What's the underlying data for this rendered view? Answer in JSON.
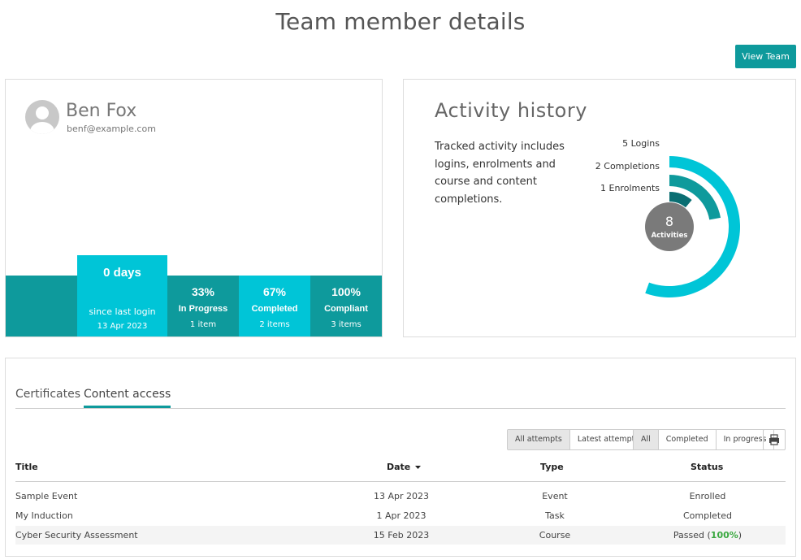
{
  "page": {
    "title": "Team member details",
    "view_team_label": "View Team"
  },
  "profile": {
    "name": "Ben Fox",
    "email": "benf@example.com",
    "last_login": {
      "value": "0 days",
      "label": "since last login",
      "date": "13 Apr 2023"
    },
    "stats": [
      {
        "value": "33%",
        "label": "In Progress",
        "sub": "1 item"
      },
      {
        "value": "67%",
        "label": "Completed",
        "sub": "2 items"
      },
      {
        "value": "100%",
        "label": "Compliant",
        "sub": "3 items"
      }
    ]
  },
  "activity": {
    "title": "Activity history",
    "description": "Tracked activity includes logins, enrolments and course and content completions.",
    "total": "8",
    "total_label": "Activities",
    "series": [
      {
        "label": "5 Logins",
        "count": 5,
        "color": "#00c5d7"
      },
      {
        "label": "2 Completions",
        "count": 2,
        "color": "#0e9a9c"
      },
      {
        "label": "1 Enrolments",
        "count": 1,
        "color": "#0a6e72"
      }
    ],
    "center_color": "#7a7a7a"
  },
  "content": {
    "tabs": [
      "Certificates",
      "Content access"
    ],
    "active_tab": "Content access",
    "attempt_filters": [
      "All attempts",
      "Latest attempts"
    ],
    "status_filters": [
      "All",
      "Completed",
      "In progress"
    ],
    "print_icon": "printer-icon",
    "columns": {
      "title": "Title",
      "date": "Date",
      "type": "Type",
      "status": "Status"
    },
    "rows": [
      {
        "title": "Sample Event",
        "date": "13 Apr 2023",
        "type": "Event",
        "status": "Enrolled",
        "pct": ""
      },
      {
        "title": "My Induction",
        "date": "1 Apr 2023",
        "type": "Task",
        "status": "Completed",
        "pct": ""
      },
      {
        "title": "Cyber Security Assessment",
        "date": "15 Feb 2023",
        "type": "Course",
        "status": "Passed (",
        "pct": "100%"
      }
    ]
  }
}
